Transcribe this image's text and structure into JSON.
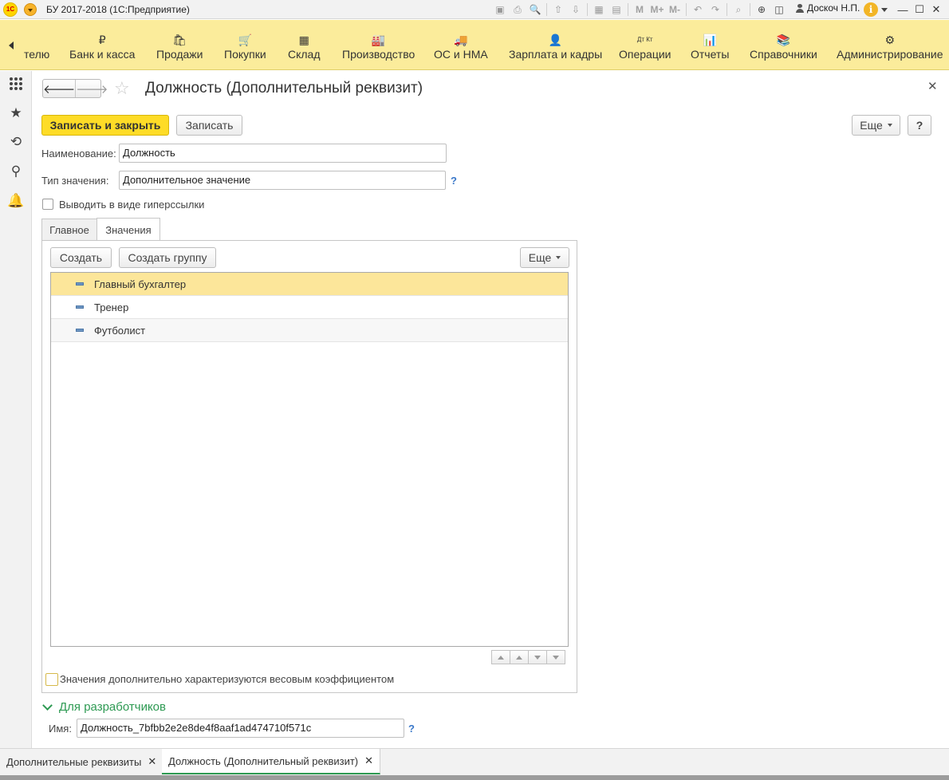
{
  "titlebar": {
    "logo": "1С",
    "app_title": "БУ 2017-2018  (1С:Предприятие)",
    "toolbar_text_buttons": [
      "M",
      "M+",
      "M-"
    ],
    "user": "Доскоч Н.П."
  },
  "sections": {
    "items": [
      {
        "label": "телю",
        "icon": ""
      },
      {
        "label": "Банк и касса",
        "icon": "₽"
      },
      {
        "label": "Продажи",
        "icon": "🛍"
      },
      {
        "label": "Покупки",
        "icon": "🛒"
      },
      {
        "label": "Склад",
        "icon": "▦"
      },
      {
        "label": "Производство",
        "icon": "🏭"
      },
      {
        "label": "ОС и НМА",
        "icon": "🚚"
      },
      {
        "label": "Зарплата и кадры",
        "icon": "👤"
      },
      {
        "label": "Операции",
        "icon": "Дт Кт"
      },
      {
        "label": "Отчеты",
        "icon": "📊"
      },
      {
        "label": "Справочники",
        "icon": "📚"
      },
      {
        "label": "Администрирование",
        "icon": "⚙"
      }
    ]
  },
  "form": {
    "title": "Должность (Дополнительный реквизит)",
    "buttons": {
      "save_close": "Записать и закрыть",
      "save": "Записать",
      "more": "Еще",
      "help": "?"
    },
    "name_label": "Наименование:",
    "name_value": "Должность",
    "type_label": "Тип значения:",
    "type_value": "Дополнительное значение",
    "hyperlink_checkbox": "Выводить в виде гиперссылки",
    "tabs": [
      "Главное",
      "Значения"
    ],
    "values": {
      "create": "Создать",
      "create_group": "Создать группу",
      "more": "Еще",
      "rows": [
        "Главный бухгалтер",
        "Тренер",
        "Футболист"
      ],
      "weight_checkbox": "Значения дополнительно характеризуются весовым коэффициентом"
    },
    "dev_section": "Для разработчиков",
    "dev_name_label": "Имя:",
    "dev_name_value": "Должность_7bfbb2e2e8de4f8aaf1ad474710f571c"
  },
  "open_windows": [
    {
      "label": "Дополнительные реквизиты"
    },
    {
      "label": "Должность (Дополнительный реквизит)"
    }
  ]
}
